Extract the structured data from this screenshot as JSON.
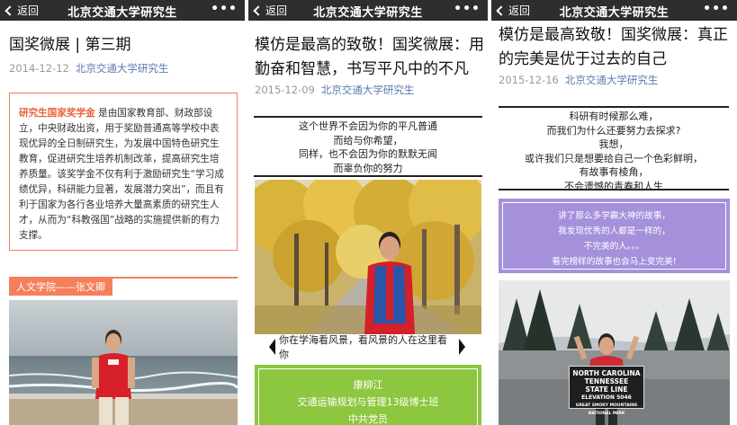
{
  "topbar": {
    "back_label": "返回",
    "title": "北京交通大学研究生",
    "more_label": "•••"
  },
  "article1": {
    "title": "国奖微展 | 第三期",
    "date": "2014-12-12",
    "account": "北京交通大学研究生",
    "intro_highlight": "研究生国家奖学金",
    "intro_body": "是由国家教育部、财政部设立，中央财政出资，用于奖励普通高等学校中表现优异的全日制研究生，为发展中国特色研究生教育，促进研究生培养机制改革，提高研究生培养质量。该奖学金不仅有利于激励研究生“学习成绩优异，科研能力显著，发展潜力突出”，而且有利于国家为各行各业培养大量高素质的研究生人才，从而为“科教强国”战略的实施提供新的有力支撑。",
    "section_tag": "人文学院——张文卿"
  },
  "article2": {
    "title": "模仿是最高的致敬！国奖微展：用勤奋和智慧，书写平凡中的不凡",
    "date": "2015-12-09",
    "account": "北京交通大学研究生",
    "poem": [
      "这个世界不会因为你的平凡普通",
      "而给与你希望，",
      "同样，也不会因为你的默默无闻",
      "而辜负你的努力"
    ],
    "photo_caption": "你在学海看风景，看风景的人在这里看你",
    "profile": [
      "康柳江",
      "交通运输规划与管理13级博士班",
      "中共党员"
    ]
  },
  "article3": {
    "title": "模仿是最高致敬！国奖微展：真正的完美是优于过去的自己",
    "date": "2015-12-16",
    "account": "北京交通大学研究生",
    "poem": [
      "科研有时候那么难，",
      "而我们为什么还要努力去探求?",
      "我想，",
      "或许我们只是想要给自己一个色彩鲜明，",
      "有故事有棱角，",
      "不会遗憾的青春和人生"
    ],
    "quote": [
      "讲了那么多学霸大神的故事，",
      "我发现优秀的人都是一样的，",
      "不完美的人。。。",
      "看完榜样的故事也会马上变完美!"
    ],
    "sign": [
      "NORTH CAROLINA",
      "TENNESSEE",
      "STATE LINE",
      "ELEVATION 5046",
      "GREAT SMOKY MOUNTAINS",
      "NATIONAL PARK"
    ]
  },
  "colors": {
    "topbar_bg": "#2e2e30",
    "accent_red": "#f08060",
    "account_link": "#5b7bb1",
    "green_box": "#8dc63f",
    "purple_box": "#a590db"
  }
}
